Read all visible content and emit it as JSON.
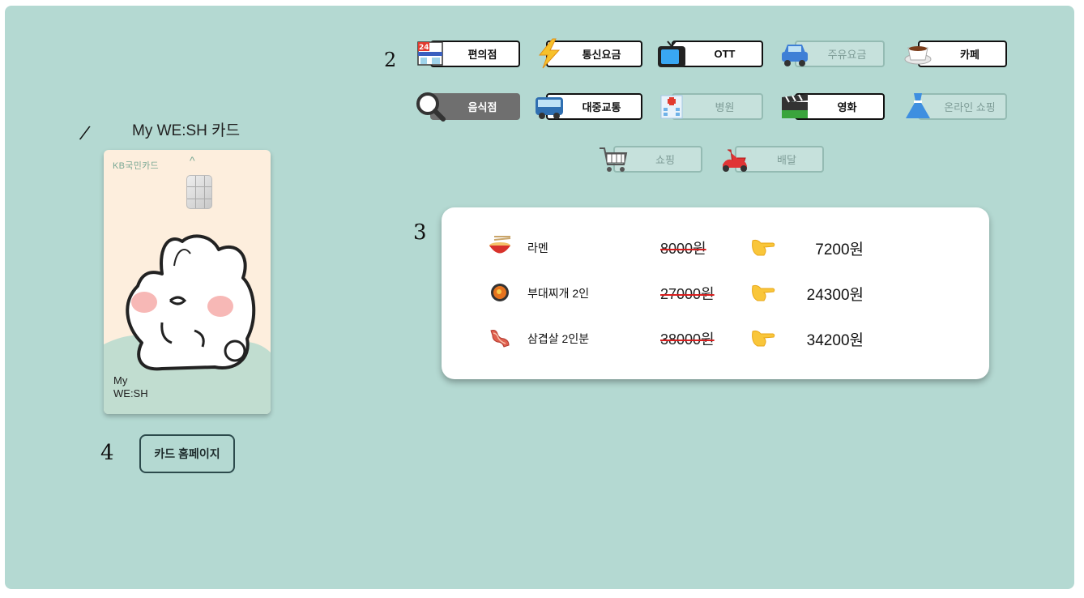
{
  "annotations": [
    "/",
    "2",
    "3",
    "4"
  ],
  "card": {
    "title": "My WE:SH 카드",
    "brand": "KB국민카드",
    "name": "My WE:SH",
    "homepage_button": "카드 홈페이지"
  },
  "categories": [
    {
      "label": "편의점",
      "state": "active",
      "icon": "convenience-store-icon"
    },
    {
      "label": "통신요금",
      "state": "active",
      "icon": "lightning-icon"
    },
    {
      "label": "OTT",
      "state": "active",
      "icon": "tv-icon"
    },
    {
      "label": "주유요금",
      "state": "disabled",
      "icon": "car-icon"
    },
    {
      "label": "카페",
      "state": "active",
      "icon": "coffee-icon"
    },
    {
      "label": "음식점",
      "state": "selected",
      "icon": "magnifier-icon"
    },
    {
      "label": "대중교통",
      "state": "active",
      "icon": "bus-icon"
    },
    {
      "label": "병원",
      "state": "disabled",
      "icon": "hospital-icon"
    },
    {
      "label": "영화",
      "state": "active",
      "icon": "clapperboard-icon"
    },
    {
      "label": "온라인 쇼핑",
      "state": "disabled",
      "icon": "dress-icon"
    },
    {
      "label": "쇼핑",
      "state": "disabled",
      "icon": "cart-icon"
    },
    {
      "label": "배달",
      "state": "disabled",
      "icon": "scooter-icon"
    }
  ],
  "results": [
    {
      "name": "라멘",
      "original": "8000원",
      "discounted": "7200원",
      "icon": "ramen-icon"
    },
    {
      "name": "부대찌개 2인",
      "original": "27000원",
      "discounted": "24300원",
      "icon": "stew-pot-icon"
    },
    {
      "name": "삼겹살 2인분",
      "original": "38000원",
      "discounted": "34200원",
      "icon": "bacon-icon"
    }
  ]
}
